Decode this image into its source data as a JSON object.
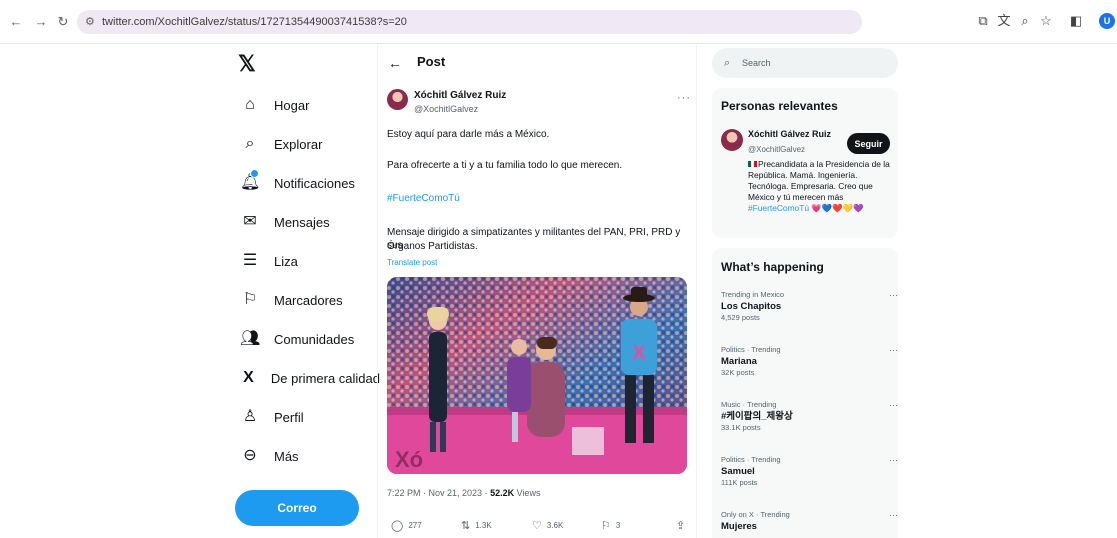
{
  "browser": {
    "url": "twitter.com/XochitlGalvez/status/1727135449003741538?s=20",
    "back_icon": "arrow-left",
    "forward_icon": "arrow-right",
    "reload_icon": "reload",
    "profile_letter": "U"
  },
  "sidebar": {
    "items": [
      {
        "label": "Hogar",
        "icon": "home-icon"
      },
      {
        "label": "Explorar",
        "icon": "search-icon"
      },
      {
        "label": "Notificaciones",
        "icon": "bell-icon"
      },
      {
        "label": "Mensajes",
        "icon": "mail-icon"
      },
      {
        "label": "Liza",
        "icon": "list-icon"
      },
      {
        "label": "Marcadores",
        "icon": "bookmark-icon"
      },
      {
        "label": "Comunidades",
        "icon": "people-icon"
      },
      {
        "label": "De primera calidad",
        "icon": "x-logo-icon"
      },
      {
        "label": "Perfil",
        "icon": "person-icon"
      },
      {
        "label": "Más",
        "icon": "more-circle-icon"
      }
    ],
    "post_button": "Correo"
  },
  "post": {
    "header_title": "Post",
    "author_name": "Xóchitl Gálvez Ruiz",
    "author_handle": "@XochitlGalvez",
    "more": "···",
    "text_line1": "Estoy aquí para darle más a México.",
    "text_line2": "Para ofrecerte a ti y a tu familia todo lo que merecen.",
    "hashtag": "#FuerteComoTú",
    "text_line4a": "Mensaje dirigido a simpatizantes y militantes del PAN, PRI, PRD y sus",
    "text_line4b": "Órganos Partidistas.",
    "translate": "Translate post",
    "timestamp": "7:22 PM · Nov 21, 2023 · ",
    "views_count": "52.2K",
    "views_label": " Views",
    "actions": {
      "replies": "277",
      "reposts": "1.3K",
      "likes": "3.6K",
      "bookmarks": "3"
    }
  },
  "right": {
    "search_placeholder": "Search",
    "relevant": {
      "title": "Personas relevantes",
      "name": "Xóchitl Gálvez Ruiz",
      "handle": "@XochitlGalvez",
      "follow": "Seguir",
      "bio": "Precandidata a la Presidencia de la República. Mamá. Ingeniería. Tecnóloga. Empresaria. Creo que México y tú merecen más ",
      "bio_hashtag": "#FuerteComoTú",
      "bio_hearts": "💗💙❤️💛💜"
    },
    "happening": {
      "title": "What’s happening",
      "trends": [
        {
          "meta": "Trending in Mexico",
          "name": "Los Chapitos",
          "count": "4,529 posts"
        },
        {
          "meta": "Politics · Trending",
          "name": "Mariana",
          "count": "32K posts"
        },
        {
          "meta": "Music · Trending",
          "name": "#케이팝의_제왕상",
          "count": "33.1K posts"
        },
        {
          "meta": "Politics · Trending",
          "name": "Samuel",
          "count": "111K posts"
        },
        {
          "meta": "Only on X · Trending",
          "name": "Mujeres",
          "count": ""
        }
      ]
    }
  },
  "colors": {
    "accent": "#1d9bf0",
    "text": "#0f1419",
    "muted": "#536471",
    "card_bg": "#f7f9f9"
  }
}
